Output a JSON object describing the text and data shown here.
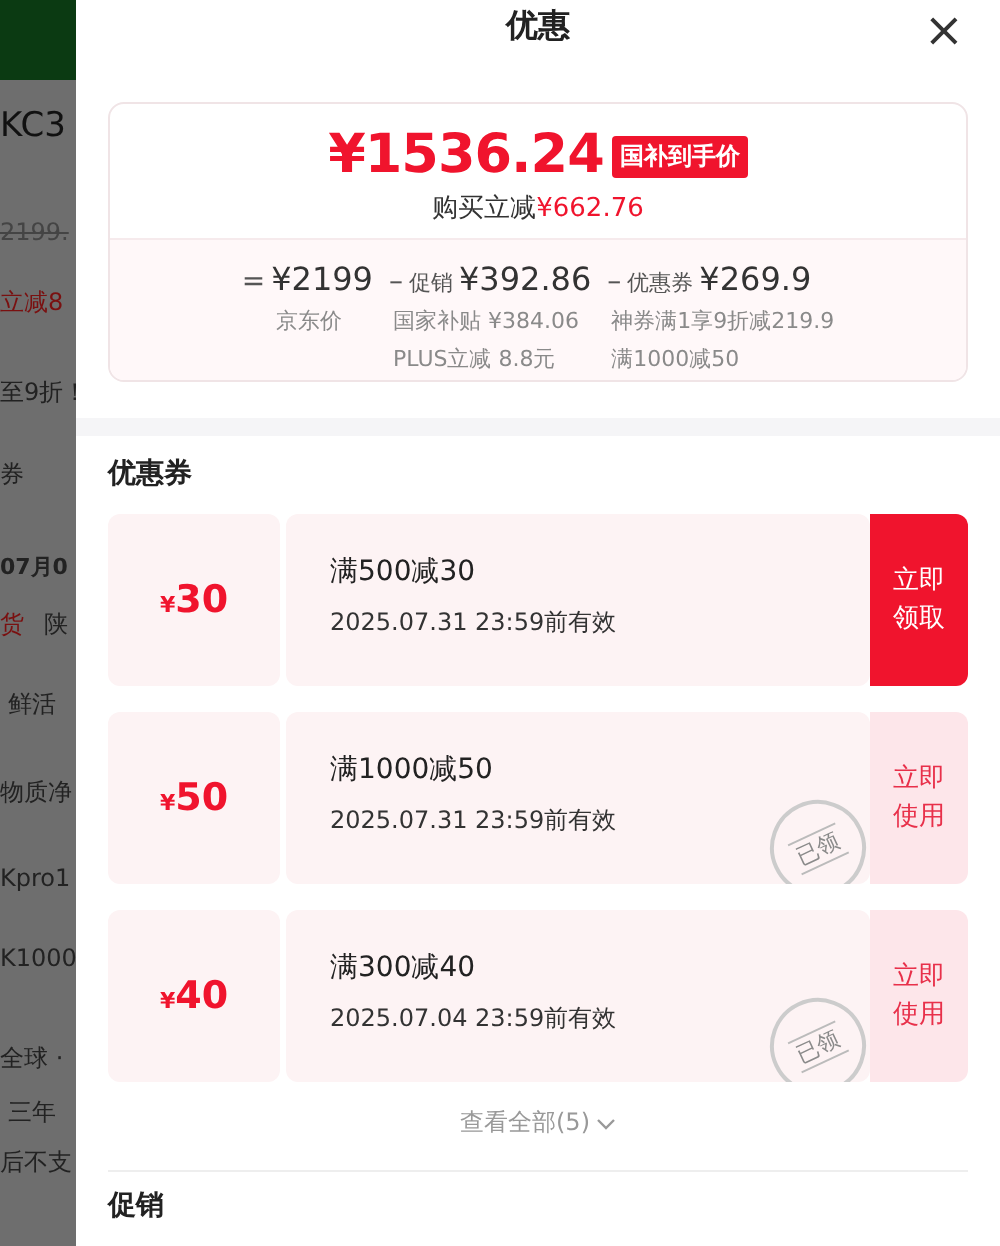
{
  "background_page": {
    "fragments": [
      {
        "text": "KC3",
        "kind": "title"
      },
      {
        "text": "2199.",
        "kind": "struck"
      },
      {
        "text": "立减8",
        "kind": "red"
      },
      {
        "text": "至9折！",
        "kind": "plain"
      },
      {
        "text": "券",
        "kind": "plain"
      },
      {
        "text": "07月0",
        "kind": "bold"
      },
      {
        "text": "货",
        "kind": "red"
      },
      {
        "text": "陕",
        "kind": "plain"
      },
      {
        "text": "鲜活",
        "kind": "plain"
      },
      {
        "text": "物质净",
        "kind": "plain"
      },
      {
        "text": "Kpro1",
        "kind": "plain"
      },
      {
        "text": "K1000",
        "kind": "plain"
      },
      {
        "text": "全球 ·",
        "kind": "plain"
      },
      {
        "text": "三年",
        "kind": "plain"
      },
      {
        "text": "后不支",
        "kind": "plain"
      }
    ]
  },
  "sheet": {
    "title": "优惠",
    "close": "×",
    "price_card": {
      "final_price": "¥1536.24",
      "badge": "国补到手价",
      "saving_label": "购买立减",
      "saving": "¥662.76",
      "breakdown": [
        {
          "op": "=",
          "amount": "¥2199",
          "notes": [
            "京东价"
          ]
        },
        {
          "op": "–",
          "label": "促销",
          "amount": "¥392.86",
          "notes": [
            "国家补贴 ¥384.06",
            "PLUS立减 8.8元"
          ]
        },
        {
          "op": "–",
          "label": "优惠券",
          "amount": "¥269.9",
          "notes": [
            "神券满1享9折减219.9",
            "满1000减50"
          ]
        }
      ]
    },
    "coupons_title": "优惠券",
    "coupons": [
      {
        "amount_symbol": "¥",
        "amount": "30",
        "condition": "满500减30",
        "validity": "2025.07.31 23:59前有效",
        "action": "立即领取",
        "claimed": false
      },
      {
        "amount_symbol": "¥",
        "amount": "50",
        "condition": "满1000减50",
        "validity": "2025.07.31 23:59前有效",
        "action": "立即使用",
        "claimed": true,
        "stamp": "已领"
      },
      {
        "amount_symbol": "¥",
        "amount": "40",
        "condition": "满300减40",
        "validity": "2025.07.04 23:59前有效",
        "action": "立即使用",
        "claimed": true,
        "stamp": "已领"
      }
    ],
    "view_all": "查看全部(5)",
    "next_section_title": "促销"
  }
}
